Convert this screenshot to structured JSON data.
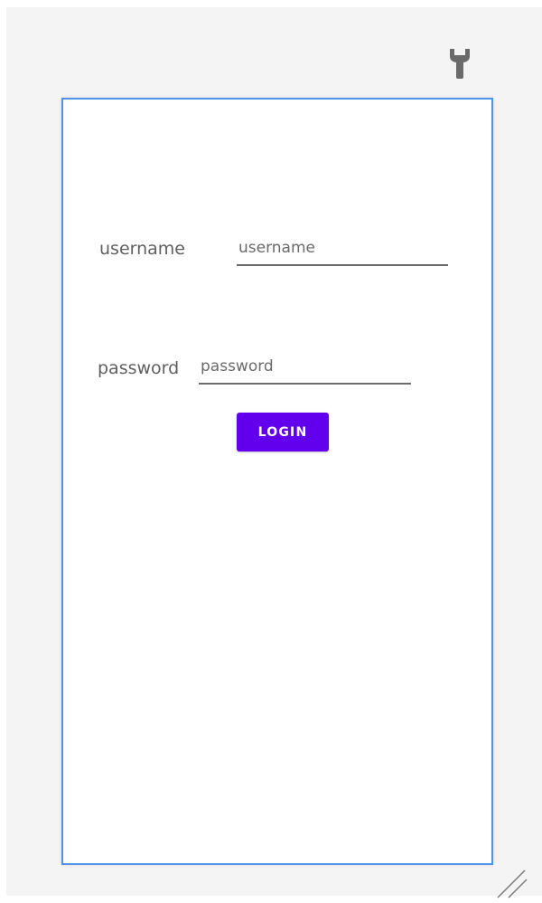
{
  "toolbar": {
    "settings_icon": "wrench-icon"
  },
  "form": {
    "username_label": "username",
    "username_placeholder": "username",
    "username_value": "",
    "password_label": "password",
    "password_placeholder": "password",
    "password_value": "",
    "login_label": "LOGIN"
  },
  "colors": {
    "accent": "#6200ee",
    "frame_border": "#4b94e6",
    "background": "#f4f4f4",
    "text": "#5f5f5f"
  }
}
